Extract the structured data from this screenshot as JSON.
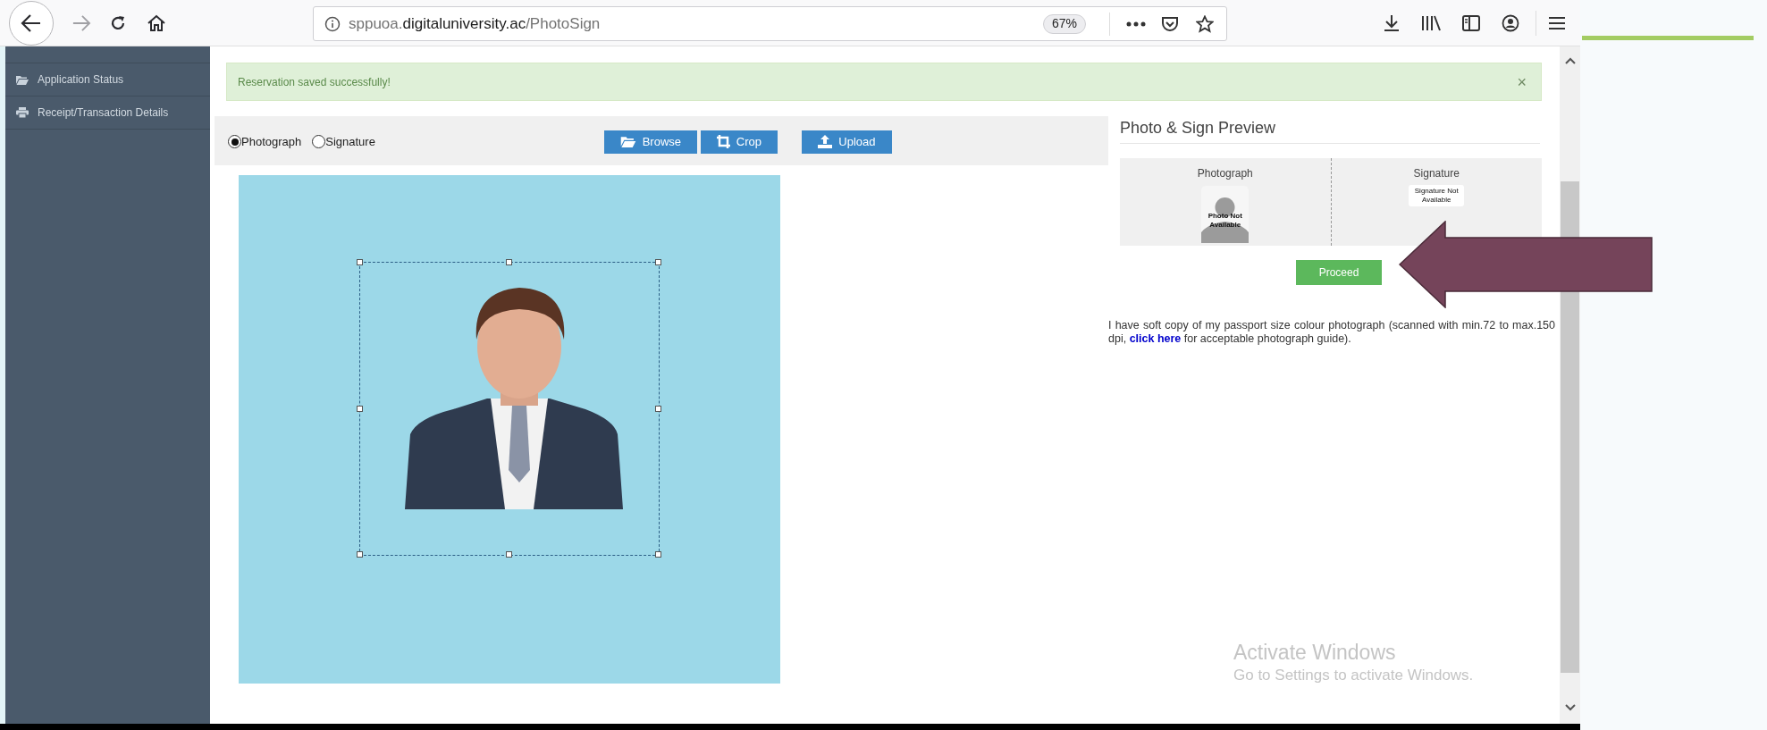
{
  "browser": {
    "url_parts": [
      {
        "text": "sppuoa.",
        "emphasis": false
      },
      {
        "text": "digitaluniversity.ac",
        "emphasis": true
      },
      {
        "text": "/PhotoSign",
        "emphasis": false
      }
    ],
    "zoom": "67%"
  },
  "sidebar": {
    "items": [
      {
        "label": "Application Status"
      },
      {
        "label": "Receipt/Transaction Details"
      }
    ]
  },
  "alert": {
    "message": "Reservation saved successfully!",
    "close": "×"
  },
  "upload_type": [
    {
      "label": "Photograph",
      "selected": true
    },
    {
      "label": "Signature",
      "selected": false
    }
  ],
  "buttons": [
    {
      "label": "Browse"
    },
    {
      "label": "Crop"
    },
    {
      "label": "Upload"
    }
  ],
  "preview": {
    "title": "Photo & Sign Preview",
    "columns": [
      {
        "heading": "Photograph",
        "placeholder_text": "Photo Not Available"
      },
      {
        "heading": "Signature",
        "kind": "signature",
        "placeholder_text": "Signature Not Available"
      }
    ],
    "proceed": "Proceed"
  },
  "note": {
    "text": "I have soft copy of my passport size colour photograph (scanned with min.72 to max.150 dpi, ",
    "link": "click here",
    "tail": " for acceptable photograph guide)."
  },
  "os_overlay": {
    "title": "Activate Windows",
    "subtitle": "Go to Settings to activate Windows."
  }
}
